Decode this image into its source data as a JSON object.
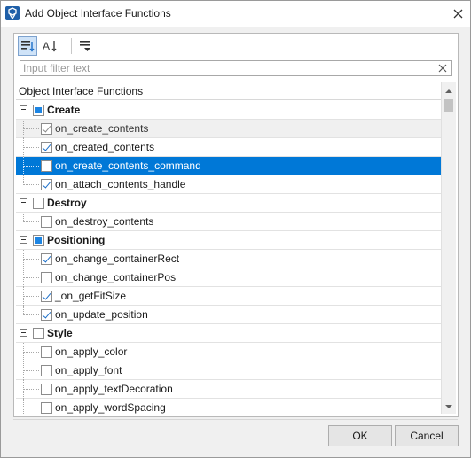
{
  "window": {
    "title": "Add Object Interface Functions"
  },
  "toolbar": {
    "buttons": [
      {
        "icon": "categorized-view-icon",
        "active": true
      },
      {
        "icon": "sort-alphabetical-icon",
        "active": false
      },
      {
        "icon": "expand-collapse-icon",
        "active": false
      }
    ]
  },
  "filter": {
    "placeholder": "Input filter text",
    "value": ""
  },
  "tree": {
    "header": "Object Interface Functions",
    "rows": [
      {
        "type": "group",
        "label": "Create",
        "check": "partial"
      },
      {
        "type": "child",
        "label": "on_create_contents",
        "check": "checked",
        "disabled": true
      },
      {
        "type": "child",
        "label": "on_created_contents",
        "check": "checked"
      },
      {
        "type": "child",
        "label": "on_create_contents_command",
        "check": "unchecked",
        "selected": true
      },
      {
        "type": "child",
        "label": "on_attach_contents_handle",
        "check": "checked",
        "last": true
      },
      {
        "type": "group",
        "label": "Destroy",
        "check": "unchecked"
      },
      {
        "type": "child",
        "label": "on_destroy_contents",
        "check": "unchecked",
        "last": true
      },
      {
        "type": "group",
        "label": "Positioning",
        "check": "partial"
      },
      {
        "type": "child",
        "label": "on_change_containerRect",
        "check": "checked"
      },
      {
        "type": "child",
        "label": "on_change_containerPos",
        "check": "unchecked"
      },
      {
        "type": "child",
        "label": "_on_getFitSize",
        "check": "checked"
      },
      {
        "type": "child",
        "label": "on_update_position",
        "check": "checked",
        "last": true
      },
      {
        "type": "group",
        "label": "Style",
        "check": "unchecked"
      },
      {
        "type": "child",
        "label": "on_apply_color",
        "check": "unchecked"
      },
      {
        "type": "child",
        "label": "on_apply_font",
        "check": "unchecked"
      },
      {
        "type": "child",
        "label": "on_apply_textDecoration",
        "check": "unchecked"
      },
      {
        "type": "child",
        "label": "on_apply_wordSpacing",
        "check": "unchecked"
      }
    ]
  },
  "footer": {
    "ok_label": "OK",
    "cancel_label": "Cancel"
  },
  "colors": {
    "selection": "#0078d7",
    "check_blue": "#1d85e3"
  }
}
